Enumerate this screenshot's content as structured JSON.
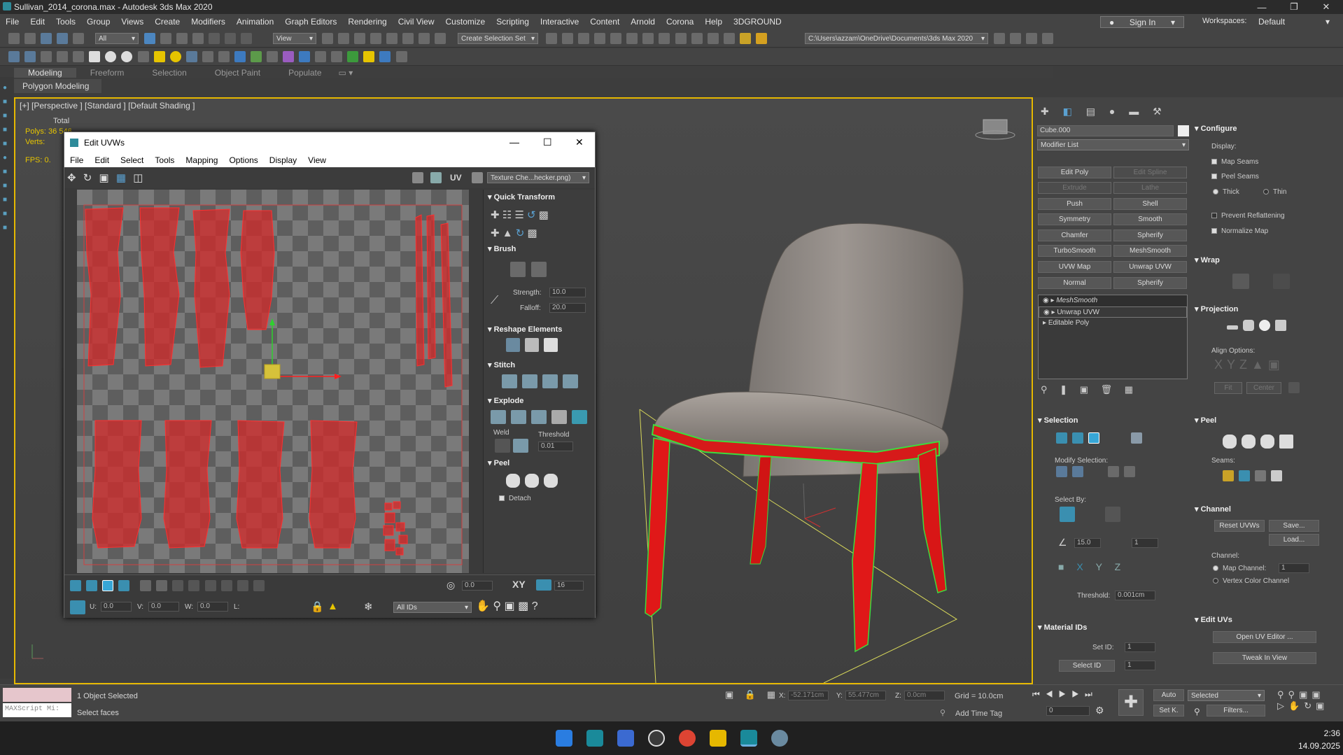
{
  "window": {
    "title": "Sullivan_2014_corona.max - Autodesk 3ds Max 2020"
  },
  "menu": [
    "File",
    "Edit",
    "Tools",
    "Group",
    "Views",
    "Create",
    "Modifiers",
    "Animation",
    "Graph Editors",
    "Rendering",
    "Civil View",
    "Customize",
    "Scripting",
    "Interactive",
    "Content",
    "Arnold",
    "Corona",
    "Help",
    "3DGROUND"
  ],
  "signin": {
    "label": "Sign In",
    "workspaces_label": "Workspaces:",
    "workspaces_value": "Default"
  },
  "toolbar": {
    "filter_value": "All",
    "view_value": "View",
    "selection_set_value": "Create Selection Set",
    "project_path": "C:\\Users\\azzam\\OneDrive\\Documents\\3ds Max 2020"
  },
  "ribbon": {
    "tabs": [
      "Modeling",
      "Freeform",
      "Selection",
      "Object Paint",
      "Populate"
    ],
    "sub": "Polygon Modeling"
  },
  "viewport": {
    "label": "[+] [Perspective ] [Standard ] [Default Shading ]",
    "stats_total": "Total",
    "polys_label": "Polys:",
    "polys_value": "36 546",
    "verts_label": "Verts:",
    "verts_value": "",
    "fps_label": "FPS:",
    "fps_value": "0."
  },
  "uv_editor": {
    "title": "Edit UVWs",
    "menu": [
      "File",
      "Edit",
      "Select",
      "Tools",
      "Mapping",
      "Options",
      "Display",
      "View"
    ],
    "uv_label": "UV",
    "texture_value": "Texture Che...hecker.png)",
    "side": {
      "quick_transform": "Quick Transform",
      "brush": "Brush",
      "strength_label": "Strength:",
      "strength_value": "10.0",
      "falloff_label": "Falloff:",
      "falloff_value": "20.0",
      "reshape": "Reshape Elements",
      "stitch": "Stitch",
      "explode": "Explode",
      "weld": "Weld",
      "threshold_label": "Threshold",
      "threshold_value": "0.01",
      "peel": "Peel",
      "detach": "Detach"
    },
    "bottom": {
      "u_label": "U:",
      "u_value": "0.0",
      "v_label": "V:",
      "v_value": "0.0",
      "w_label": "W:",
      "w_value": "0.0",
      "l_label": "L:",
      "rotate_value": "0.0",
      "xy_label": "XY",
      "grid_value": "16",
      "ids_value": "All IDs"
    }
  },
  "command_panel": {
    "object_name": "Cube.000",
    "modifier_list": "Modifier List",
    "buttons": [
      [
        "Edit Poly",
        "Edit Spline"
      ],
      [
        "Extrude",
        "Lathe"
      ],
      [
        "Push",
        "Shell"
      ],
      [
        "Symmetry",
        "Smooth"
      ],
      [
        "Chamfer",
        "Spherify"
      ],
      [
        "TurboSmooth",
        "MeshSmooth"
      ],
      [
        "UVW Map",
        "Unwrap UVW"
      ],
      [
        "Normal",
        "Spherify"
      ]
    ],
    "stack": [
      "MeshSmooth",
      "Unwrap UVW",
      "Editable Poly"
    ],
    "selection": {
      "title": "Selection",
      "modify_selection": "Modify Selection:",
      "select_by": "Select By:",
      "angle_value": "15.0",
      "grow_value": "1",
      "threshold_label": "Threshold:",
      "threshold_value": "0.001cm"
    },
    "material_ids": {
      "title": "Material IDs",
      "set_id_label": "Set ID:",
      "set_id_value": "1",
      "select_id_label": "Select ID",
      "select_id_value": "1"
    },
    "configure": {
      "title": "Configure",
      "display": "Display:",
      "map_seams": "Map Seams",
      "peel_seams": "Peel Seams",
      "thick": "Thick",
      "thin": "Thin",
      "prevent": "Prevent Reflattening",
      "normalize": "Normalize Map"
    },
    "wrap": "Wrap",
    "projection": {
      "title": "Projection",
      "align": "Align Options:",
      "fit": "Fit",
      "center": "Center"
    },
    "peel": {
      "title": "Peel",
      "seams": "Seams:"
    },
    "channel": {
      "title": "Channel",
      "reset": "Reset UVWs",
      "save": "Save...",
      "load": "Load...",
      "channel_label": "Channel:",
      "map_channel": "Map Channel:",
      "map_channel_value": "1",
      "vertex_color": "Vertex Color Channel"
    },
    "edit_uvs": {
      "title": "Edit UVs",
      "open": "Open UV Editor ...",
      "tweak": "Tweak In View"
    }
  },
  "status": {
    "script_label": "MAXScript Mi:",
    "selected": "1 Object Selected",
    "prompt": "Select faces",
    "x_label": "X:",
    "x_value": "-52.171cm",
    "y_label": "Y:",
    "y_value": "55.477cm",
    "z_label": "Z:",
    "z_value": "0.0cm",
    "grid": "Grid = 10.0cm",
    "add_time_tag": "Add Time Tag",
    "auto": "Auto",
    "set_k": "Set K.",
    "selected_dd": "Selected",
    "filters": "Filters...",
    "frame_value": "0"
  },
  "clock": {
    "time": "2:36",
    "date": "14.09.2025"
  },
  "colors": {
    "accent": "#e6b800",
    "uv_red": "#d42a2a",
    "legs": "#e01818",
    "selection_green": "#3ddc3d"
  }
}
